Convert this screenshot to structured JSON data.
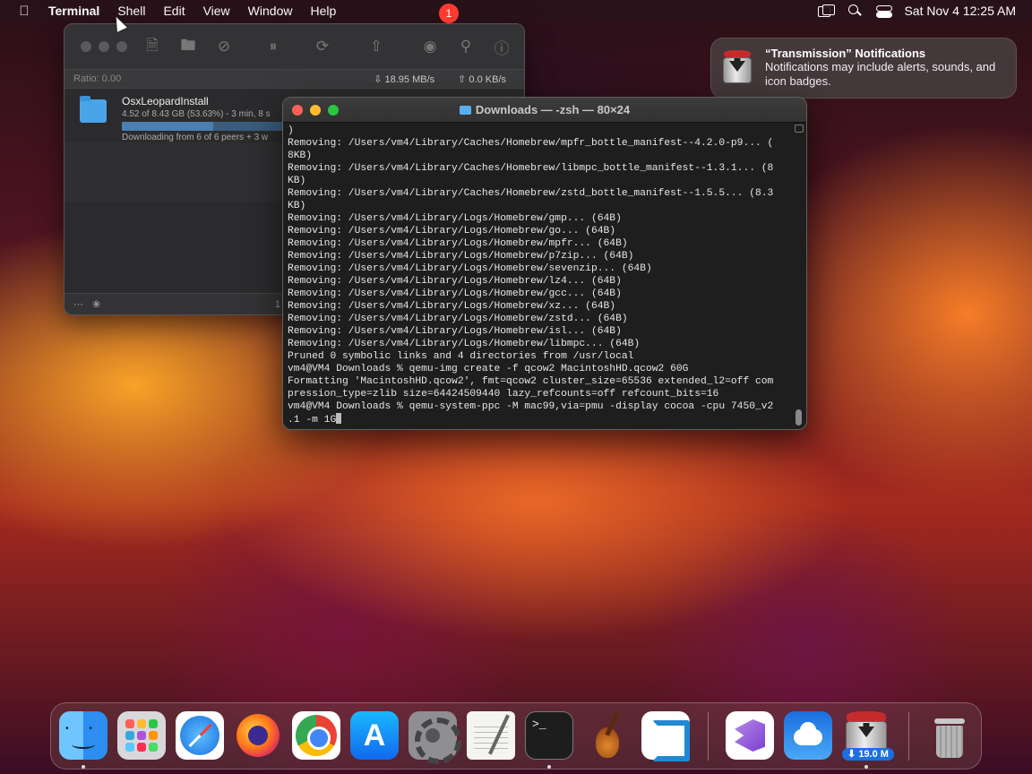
{
  "menubar": {
    "app_name": "Terminal",
    "menus": [
      "Shell",
      "Edit",
      "View",
      "Window",
      "Help"
    ],
    "clock": "Sat Nov 4  12:25 AM"
  },
  "transmission": {
    "ratio": "Ratio: 0.00",
    "download_speed": "18.95 MB/s",
    "upload_speed": "0.0 KB/s",
    "torrent": {
      "name": "OsxLeopardInstall",
      "progress_text": "4.52 of 8.43 GB (53.63%) - 3 min, 8 s",
      "progress_fraction": 0.5363,
      "peers_text": "Downloading from 6 of 6 peers + 3 w"
    },
    "footer_count": "1"
  },
  "terminal": {
    "title": "Downloads — -zsh — 80×24",
    "lines": [
      ")",
      "Removing: /Users/vm4/Library/Caches/Homebrew/mpfr_bottle_manifest--4.2.0-p9... (",
      "8KB)",
      "Removing: /Users/vm4/Library/Caches/Homebrew/libmpc_bottle_manifest--1.3.1... (8",
      "KB)",
      "Removing: /Users/vm4/Library/Caches/Homebrew/zstd_bottle_manifest--1.5.5... (8.3",
      "KB)",
      "Removing: /Users/vm4/Library/Logs/Homebrew/gmp... (64B)",
      "Removing: /Users/vm4/Library/Logs/Homebrew/go... (64B)",
      "Removing: /Users/vm4/Library/Logs/Homebrew/mpfr... (64B)",
      "Removing: /Users/vm4/Library/Logs/Homebrew/p7zip... (64B)",
      "Removing: /Users/vm4/Library/Logs/Homebrew/sevenzip... (64B)",
      "Removing: /Users/vm4/Library/Logs/Homebrew/lz4... (64B)",
      "Removing: /Users/vm4/Library/Logs/Homebrew/gcc... (64B)",
      "Removing: /Users/vm4/Library/Logs/Homebrew/xz... (64B)",
      "Removing: /Users/vm4/Library/Logs/Homebrew/zstd... (64B)",
      "Removing: /Users/vm4/Library/Logs/Homebrew/isl... (64B)",
      "Removing: /Users/vm4/Library/Logs/Homebrew/libmpc... (64B)",
      "Pruned 0 symbolic links and 4 directories from /usr/local",
      "vm4@VM4 Downloads % qemu-img create -f qcow2 MacintoshHD.qcow2 60G",
      "Formatting 'MacintoshHD.qcow2', fmt=qcow2 cluster_size=65536 extended_l2=off com",
      "pression_type=zlib size=64424509440 lazy_refcounts=off refcount_bits=16",
      "vm4@VM4 Downloads % qemu-system-ppc -M mac99,via=pmu -display cocoa -cpu 7450_v2"
    ],
    "current_input": ".1 -m 1G"
  },
  "notification": {
    "title": "“Transmission” Notifications",
    "body": "Notifications may include alerts, sounds, and icon badges."
  },
  "dock": {
    "settings_badge": "1",
    "transmission_label": "⬇ 19.0 M"
  }
}
